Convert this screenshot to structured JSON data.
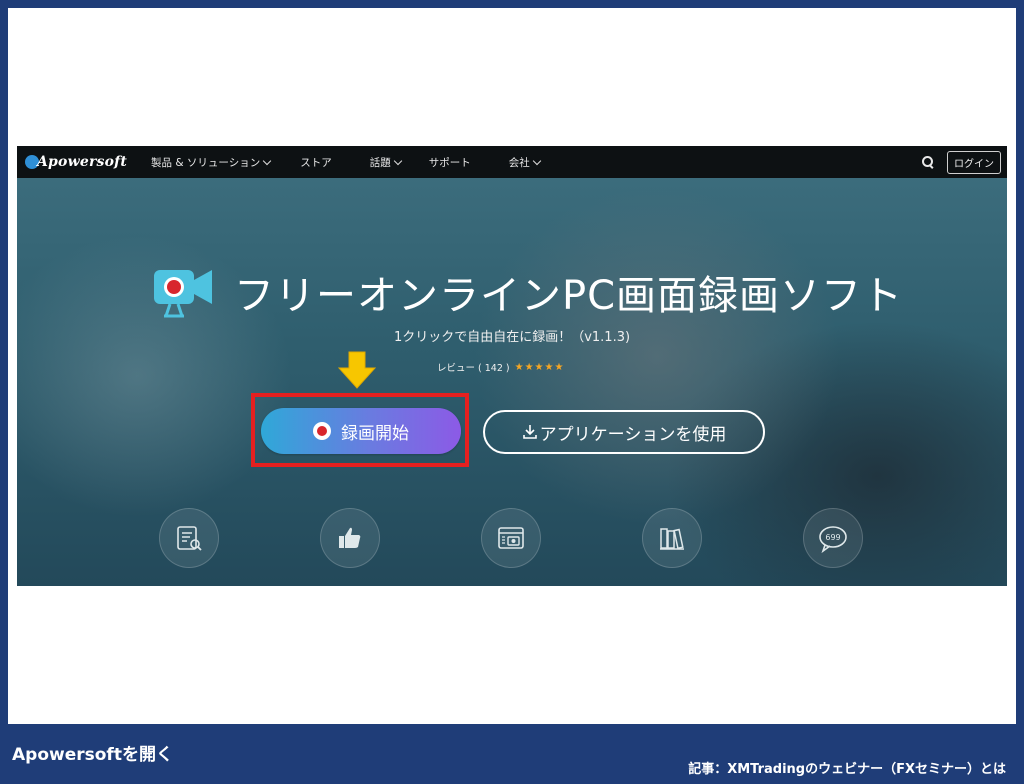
{
  "navbar": {
    "logo": "Apowersoft",
    "items": [
      {
        "label": "製品 & ソリューション",
        "has_dropdown": true
      },
      {
        "label": "ストア",
        "has_dropdown": false
      },
      {
        "label": "話題",
        "has_dropdown": true
      },
      {
        "label": "サポート",
        "has_dropdown": false
      },
      {
        "label": "会社",
        "has_dropdown": true
      }
    ],
    "search_icon": "search-icon",
    "login_label": "ログイン"
  },
  "hero": {
    "title": "フリーオンラインPC画面録画ソフト",
    "subtitle": "1クリックで自由自在に録画！（v1.1.3)",
    "review_label": "レビュー ( 142 )",
    "stars": "★★★★★",
    "rating": 4.5,
    "record_button": "録画開始",
    "app_button": "アプリケーションを使用",
    "feature_icons": [
      "document-search-icon",
      "thumbs-up-icon",
      "browser-camera-icon",
      "books-icon",
      "speech-bubble-699-icon"
    ],
    "bubble_count": "699"
  },
  "colors": {
    "frame": "#1f3d78",
    "highlight": "#e52020",
    "arrow": "#f7c600",
    "record_dot": "#d8262d",
    "star": "#f5a623"
  },
  "caption": {
    "left": "Apowersoftを開く",
    "right": "記事：XMTradingのウェビナー（FXセミナー）とは"
  }
}
